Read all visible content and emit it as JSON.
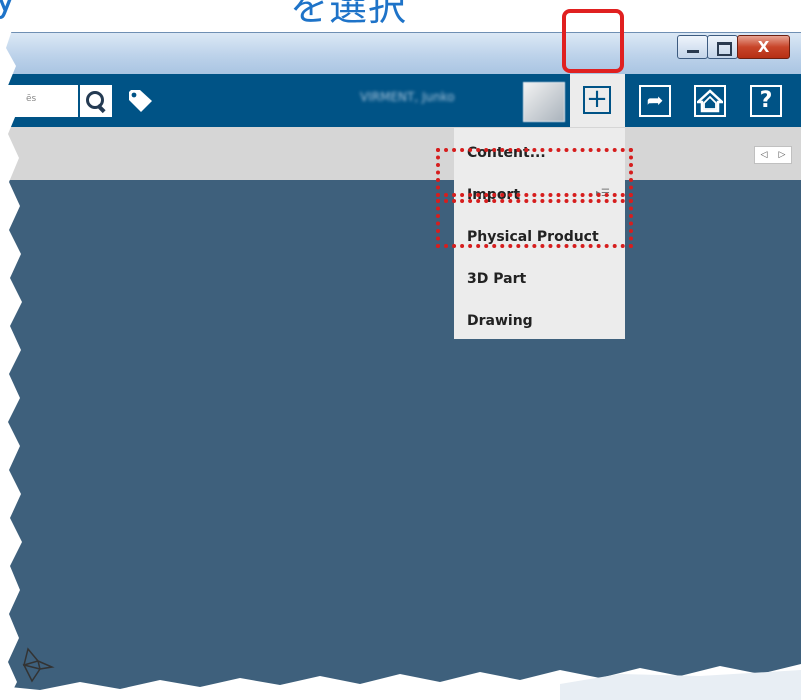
{
  "heading": {
    "left": "y",
    "right": "を選択"
  },
  "titlebar": {
    "minimize": "_",
    "maximize": "",
    "close": "X"
  },
  "toolbar": {
    "search_placeholder": "ēs",
    "user_name": "VIRMENT, Junko",
    "add_symbol": "+",
    "help_symbol": "?"
  },
  "subbar": {
    "scroll_left": "◁",
    "scroll_right": "▷"
  },
  "menu": {
    "items": [
      "Content...",
      "Import",
      "Physical Product",
      "3D Part",
      "Drawing"
    ],
    "submenu_mark": "▸☰"
  },
  "colors": {
    "toolbar": "#005386",
    "content": "#3e607c",
    "menu": "#ececec",
    "highlight": "#e02020"
  }
}
